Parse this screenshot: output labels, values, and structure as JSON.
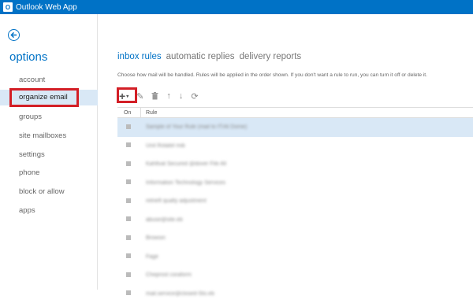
{
  "app": {
    "title": "Outlook Web App",
    "logo_glyph": "O"
  },
  "sidebar": {
    "back_icon": "back-arrow-icon",
    "title": "options",
    "items": [
      {
        "label": "account",
        "selected": false
      },
      {
        "label": "organize email",
        "selected": true
      },
      {
        "label": "groups",
        "selected": false
      },
      {
        "label": "site mailboxes",
        "selected": false
      },
      {
        "label": "settings",
        "selected": false
      },
      {
        "label": "phone",
        "selected": false
      },
      {
        "label": "block or allow",
        "selected": false
      },
      {
        "label": "apps",
        "selected": false
      }
    ]
  },
  "main": {
    "tabs": [
      {
        "label": "inbox rules",
        "active": true
      },
      {
        "label": "automatic replies",
        "active": false
      },
      {
        "label": "delivery reports",
        "active": false
      }
    ],
    "description": "Choose how mail will be handled. Rules will be applied in the order shown. If you don't want a rule to run, you can turn it off or delete it.",
    "toolbar": {
      "add": "+",
      "add_caret": "▾",
      "edit": "✎",
      "delete": "🗑",
      "move_up": "↑",
      "move_down": "↓",
      "refresh": "⟳"
    },
    "table": {
      "columns": [
        "On",
        "Rule"
      ],
      "rows": [
        {
          "rule": "Sample of Your Rule (mail to IT/At Dome)",
          "selected": true
        },
        {
          "rule": "Unit Rotatel mib",
          "selected": false
        },
        {
          "rule": "Kahltval Secured @dover File All",
          "selected": false
        },
        {
          "rule": "Information Technology Services",
          "selected": false
        },
        {
          "rule": "retrieft qualty adjustment",
          "selected": false
        },
        {
          "rule": "abuse@site.eb",
          "selected": false
        },
        {
          "rule": "Browsin",
          "selected": false
        },
        {
          "rule": "Fage",
          "selected": false
        },
        {
          "rule": "Cheprost coraform",
          "selected": false
        },
        {
          "rule": "mail.service@closed-Sto.eb",
          "selected": false
        }
      ]
    }
  },
  "colors": {
    "brand": "#0072c6",
    "highlight": "#d9e8f6",
    "annotation": "#d31f26"
  }
}
